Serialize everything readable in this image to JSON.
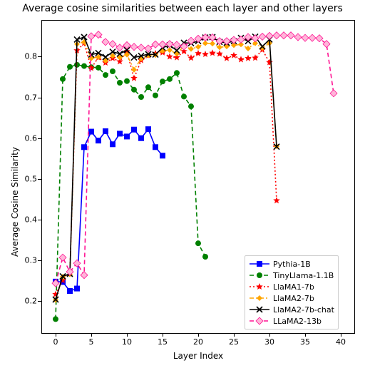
{
  "chart_data": {
    "type": "line",
    "title": "Average cosine similarities between each layer and other layers",
    "xlabel": "Layer Index",
    "ylabel": "Average Cosine Similarity",
    "xlim": [
      -2,
      42
    ],
    "ylim": [
      0.12,
      0.89
    ],
    "xticks": [
      0,
      5,
      10,
      15,
      20,
      25,
      30,
      35,
      40
    ],
    "yticks": [
      0.2,
      0.3,
      0.4,
      0.5,
      0.6,
      0.7,
      0.8
    ],
    "series": [
      {
        "name": "Pythia-1B",
        "color": "#0000ff",
        "linestyle": "solid",
        "marker": "square_filled",
        "x": [
          0,
          1,
          2,
          3,
          4,
          5,
          6,
          7,
          8,
          9,
          10,
          11,
          12,
          13,
          14,
          15
        ],
        "values": [
          0.248,
          0.247,
          0.225,
          0.231,
          0.578,
          0.616,
          0.594,
          0.617,
          0.585,
          0.611,
          0.604,
          0.621,
          0.6,
          0.622,
          0.578,
          0.557
        ]
      },
      {
        "name": "TinyLlama-1.1B",
        "color": "#008000",
        "linestyle": "dashed",
        "marker": "circle_filled",
        "x": [
          0,
          1,
          2,
          3,
          4,
          5,
          6,
          7,
          8,
          9,
          10,
          11,
          12,
          13,
          14,
          15,
          16,
          17,
          18,
          19,
          20,
          21
        ],
        "values": [
          0.156,
          0.745,
          0.775,
          0.78,
          0.777,
          0.774,
          0.773,
          0.755,
          0.764,
          0.736,
          0.74,
          0.719,
          0.701,
          0.725,
          0.705,
          0.739,
          0.745,
          0.76,
          0.702,
          0.678,
          0.342,
          0.309
        ]
      },
      {
        "name": "LlaMA1-7b",
        "color": "#ff0000",
        "linestyle": "dotted",
        "marker": "star",
        "x": [
          0,
          1,
          2,
          3,
          4,
          5,
          6,
          7,
          8,
          9,
          10,
          11,
          12,
          13,
          14,
          15,
          16,
          17,
          18,
          19,
          20,
          21,
          22,
          23,
          24,
          25,
          26,
          27,
          28,
          29,
          30,
          31
        ],
        "values": [
          0.217,
          0.251,
          0.269,
          0.815,
          0.833,
          0.772,
          0.798,
          0.785,
          0.796,
          0.788,
          0.813,
          0.747,
          0.791,
          0.803,
          0.808,
          0.81,
          0.8,
          0.798,
          0.813,
          0.797,
          0.808,
          0.806,
          0.809,
          0.807,
          0.796,
          0.803,
          0.793,
          0.796,
          0.797,
          0.817,
          0.786,
          0.447
        ]
      },
      {
        "name": "LlaMA2-7b",
        "color": "#ffa500",
        "linestyle": "dashdot",
        "marker": "diamond_filled",
        "x": [
          0,
          1,
          2,
          3,
          4,
          5,
          6,
          7,
          8,
          9,
          10,
          11,
          12,
          13,
          14,
          15,
          16,
          17,
          18,
          19,
          20,
          21,
          22,
          23,
          24,
          25,
          26,
          27,
          28,
          29,
          30,
          31
        ],
        "values": [
          0.203,
          0.26,
          0.266,
          0.831,
          0.836,
          0.796,
          0.799,
          0.79,
          0.802,
          0.798,
          0.805,
          0.768,
          0.795,
          0.803,
          0.804,
          0.814,
          0.816,
          0.807,
          0.826,
          0.819,
          0.824,
          0.833,
          0.832,
          0.823,
          0.825,
          0.828,
          0.83,
          0.82,
          0.833,
          0.821,
          0.833,
          0.58
        ]
      },
      {
        "name": "LlaMA2-7b-chat",
        "color": "#000000",
        "linestyle": "solid",
        "marker": "x_marker",
        "x": [
          0,
          1,
          2,
          3,
          4,
          5,
          6,
          7,
          8,
          9,
          10,
          11,
          12,
          13,
          14,
          15,
          16,
          17,
          18,
          19,
          20,
          21,
          22,
          23,
          24,
          25,
          26,
          27,
          28,
          29,
          30,
          31
        ],
        "values": [
          0.204,
          0.261,
          0.267,
          0.842,
          0.848,
          0.805,
          0.809,
          0.799,
          0.812,
          0.807,
          0.816,
          0.798,
          0.802,
          0.806,
          0.805,
          0.822,
          0.828,
          0.815,
          0.834,
          0.833,
          0.838,
          0.847,
          0.848,
          0.836,
          0.834,
          0.838,
          0.846,
          0.838,
          0.849,
          0.825,
          0.842,
          0.579
        ]
      },
      {
        "name": "LLaMA2-13b",
        "color": "#ff1493",
        "linestyle": "dashed",
        "marker": "diamond_filled_pink",
        "x": [
          0,
          1,
          2,
          3,
          4,
          5,
          6,
          7,
          8,
          9,
          10,
          11,
          12,
          13,
          14,
          15,
          16,
          17,
          18,
          19,
          20,
          21,
          22,
          23,
          24,
          25,
          26,
          27,
          28,
          29,
          30,
          31,
          32,
          33,
          34,
          35,
          36,
          37,
          38,
          39
        ],
        "values": [
          0.244,
          0.307,
          0.272,
          0.293,
          0.264,
          0.85,
          0.854,
          0.836,
          0.831,
          0.822,
          0.828,
          0.824,
          0.822,
          0.82,
          0.83,
          0.83,
          0.831,
          0.829,
          0.825,
          0.839,
          0.844,
          0.847,
          0.847,
          0.838,
          0.838,
          0.841,
          0.842,
          0.848,
          0.845,
          0.849,
          0.851,
          0.852,
          0.852,
          0.852,
          0.848,
          0.846,
          0.846,
          0.845,
          0.831,
          0.71
        ]
      }
    ],
    "legend": {
      "position": "lower-right",
      "entries": [
        "Pythia-1B",
        "TinyLlama-1.1B",
        "LlaMA1-7b",
        "LlaMA2-7b",
        "LlaMA2-7b-chat",
        "LLaMA2-13b"
      ]
    }
  }
}
